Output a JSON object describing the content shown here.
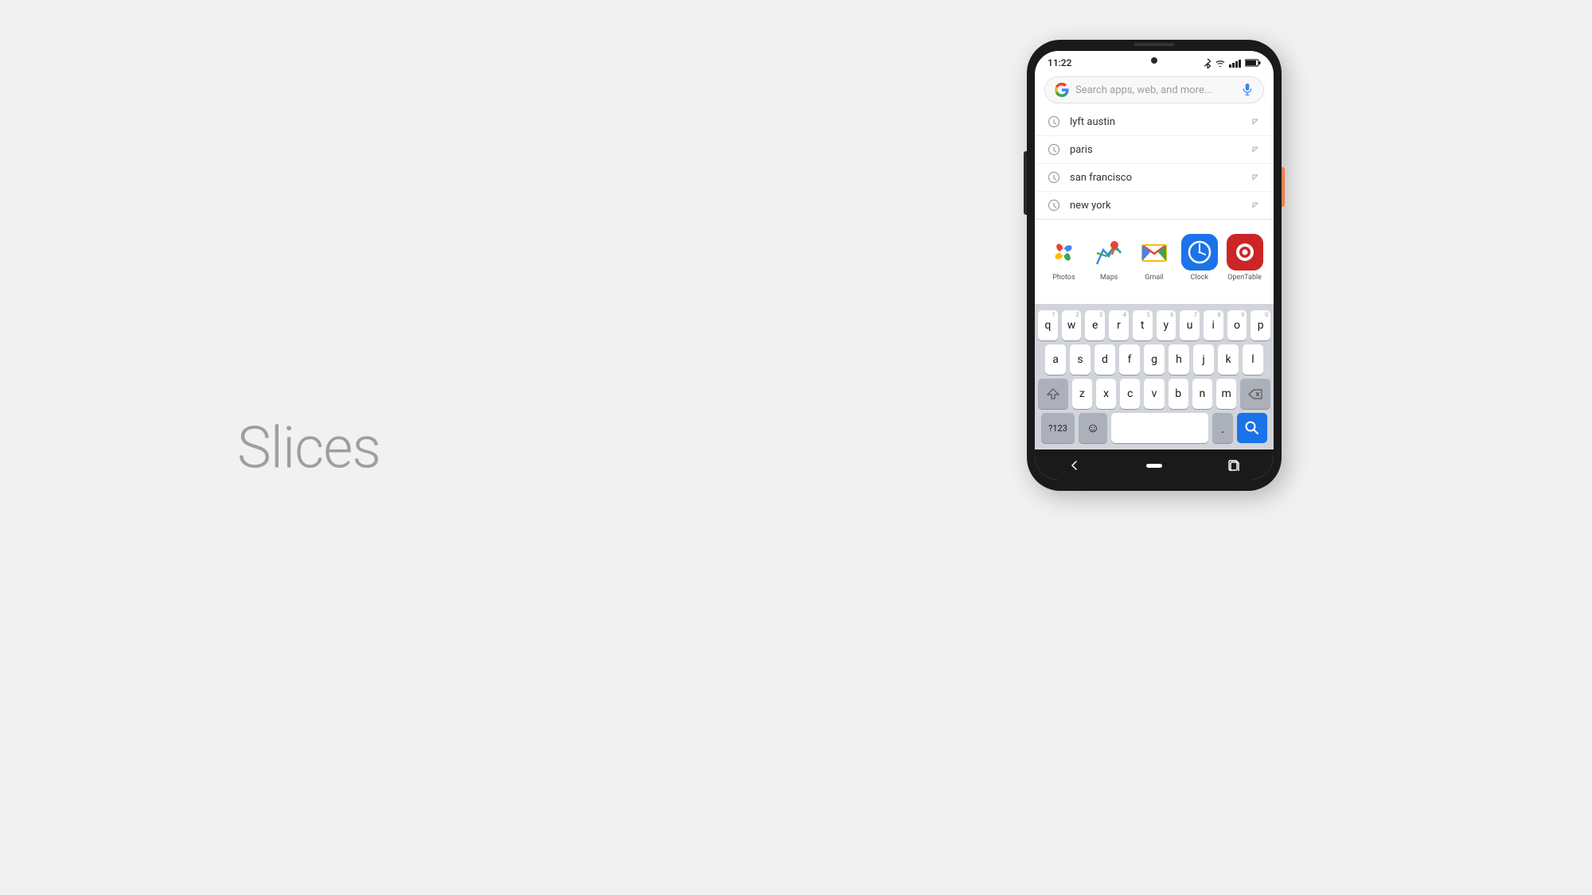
{
  "page": {
    "title": "Slices",
    "background": "#f1f1f1"
  },
  "phone": {
    "status_bar": {
      "time": "11:22",
      "bluetooth": "✱",
      "wifi": "▲",
      "signal": "▋▋▋",
      "battery": "▊"
    },
    "search": {
      "placeholder": "Search apps, web, and more...",
      "google_g": "G"
    },
    "suggestions": [
      {
        "text": "lyft austin"
      },
      {
        "text": "paris"
      },
      {
        "text": "san francisco"
      },
      {
        "text": "new york"
      }
    ],
    "apps": [
      {
        "name": "Photos",
        "icon_type": "photos"
      },
      {
        "name": "Maps",
        "icon_type": "maps"
      },
      {
        "name": "Gmail",
        "icon_type": "gmail"
      },
      {
        "name": "Clock",
        "icon_type": "clock"
      },
      {
        "name": "OpenTable",
        "icon_type": "opentable"
      }
    ],
    "keyboard": {
      "rows": [
        [
          "q",
          "w",
          "e",
          "r",
          "t",
          "y",
          "u",
          "i",
          "o",
          "p"
        ],
        [
          "a",
          "s",
          "d",
          "f",
          "g",
          "h",
          "j",
          "k",
          "l"
        ],
        [
          "z",
          "x",
          "c",
          "v",
          "b",
          "n",
          "m"
        ]
      ],
      "num_hints": [
        "1",
        "2",
        "3",
        "4",
        "5",
        "6",
        "7",
        "8",
        "9",
        "0"
      ],
      "bottom": {
        "special": "?123",
        "comma": ",",
        "period": ".",
        "search_icon": "🔍"
      }
    }
  }
}
